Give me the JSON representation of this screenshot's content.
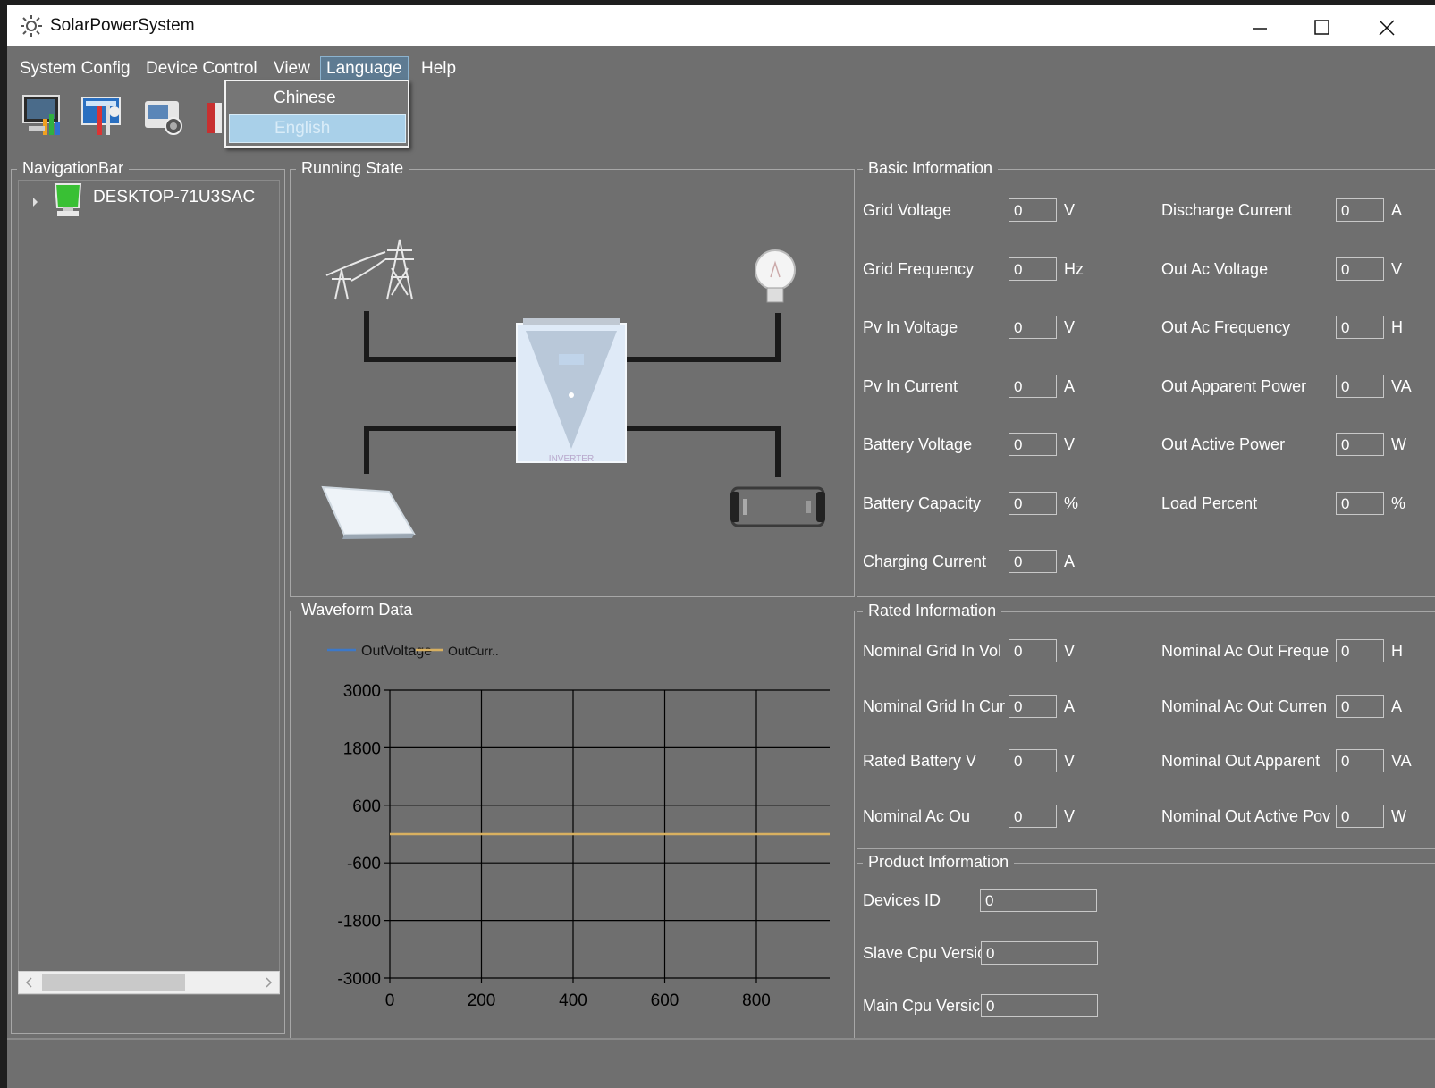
{
  "window": {
    "title": "SolarPowerSystem",
    "minimize_icon": "minimize-icon",
    "maximize_icon": "maximize-icon",
    "close_icon": "close-icon"
  },
  "menu": {
    "items": [
      "System Config",
      "Device Control",
      "View",
      "Language",
      "Help"
    ],
    "active": "Language"
  },
  "language_menu": {
    "items": [
      "Chinese",
      "English"
    ],
    "highlighted": "English"
  },
  "toolbar": {
    "icons": [
      "monitor-chart-icon",
      "settings-tools-icon",
      "camera-icon",
      "book-icon"
    ]
  },
  "navigation": {
    "title": "NavigationBar",
    "device": "DESKTOP-71U3SAC"
  },
  "running_state": {
    "title": "Running State",
    "inverter_label": "INVERTER",
    "components": [
      "power-tower-icon",
      "light-bulb-icon",
      "inverter-icon",
      "solar-panel-icon",
      "battery-icon"
    ]
  },
  "waveform": {
    "title": "Waveform Data"
  },
  "chart_data": {
    "type": "line",
    "series": [
      {
        "name": "OutVoltage",
        "color": "#3c78c8",
        "x": [],
        "y": []
      },
      {
        "name": "OutCurr..",
        "color": "#d8b060",
        "x": [
          0,
          960
        ],
        "y": [
          0,
          0
        ]
      }
    ],
    "legend": [
      "OutVoltage",
      "OutCurr.."
    ],
    "legend_position": "top-left",
    "x_ticks": [
      "0",
      "200",
      "400",
      "600",
      "800"
    ],
    "y_ticks": [
      "3000",
      "1800",
      "600",
      "-600",
      "-1800",
      "-3000"
    ],
    "xlim": [
      0,
      960
    ],
    "ylim": [
      -3000,
      3000
    ],
    "grid": true
  },
  "basic_info": {
    "title": "Basic Information",
    "left": [
      {
        "label": "Grid Voltage",
        "value": "0",
        "unit": "V"
      },
      {
        "label": "Grid Frequency",
        "value": "0",
        "unit": "Hz"
      },
      {
        "label": "Pv In Voltage",
        "value": "0",
        "unit": "V"
      },
      {
        "label": "Pv In Current",
        "value": "0",
        "unit": "A"
      },
      {
        "label": "Battery Voltage",
        "value": "0",
        "unit": "V"
      },
      {
        "label": "Battery Capacity",
        "value": "0",
        "unit": "%"
      },
      {
        "label": "Charging Current",
        "value": "0",
        "unit": "A"
      }
    ],
    "right": [
      {
        "label": "Discharge Current",
        "value": "0",
        "unit": "A"
      },
      {
        "label": "Out Ac Voltage",
        "value": "0",
        "unit": "V"
      },
      {
        "label": "Out Ac Frequency",
        "value": "0",
        "unit": "H"
      },
      {
        "label": "Out Apparent Power",
        "value": "0",
        "unit": "VA"
      },
      {
        "label": "Out Active Power",
        "value": "0",
        "unit": "W"
      },
      {
        "label": "Load Percent",
        "value": "0",
        "unit": "%"
      }
    ]
  },
  "rated_info": {
    "title": "Rated Information",
    "left": [
      {
        "label": "Nominal Grid In Vol",
        "value": "0",
        "unit": "V"
      },
      {
        "label": "Nominal Grid In Cur",
        "value": "0",
        "unit": "A"
      },
      {
        "label": "Rated Battery V",
        "value": "0",
        "unit": "V"
      },
      {
        "label": "Nominal Ac Ou",
        "value": "0",
        "unit": "V"
      }
    ],
    "right": [
      {
        "label": "Nominal Ac Out Freque",
        "value": "0",
        "unit": "H"
      },
      {
        "label": "Nominal Ac Out Curren",
        "value": "0",
        "unit": "A"
      },
      {
        "label": "Nominal Out Apparent",
        "value": "0",
        "unit": "VA"
      },
      {
        "label": "Nominal Out Active Pov",
        "value": "0",
        "unit": "W"
      }
    ]
  },
  "product_info": {
    "title": "Product Information",
    "rows": [
      {
        "label": "Devices ID",
        "value": "0"
      },
      {
        "label": "Slave Cpu Versic",
        "value": "0"
      },
      {
        "label": "Main Cpu Versic",
        "value": "0"
      }
    ]
  }
}
